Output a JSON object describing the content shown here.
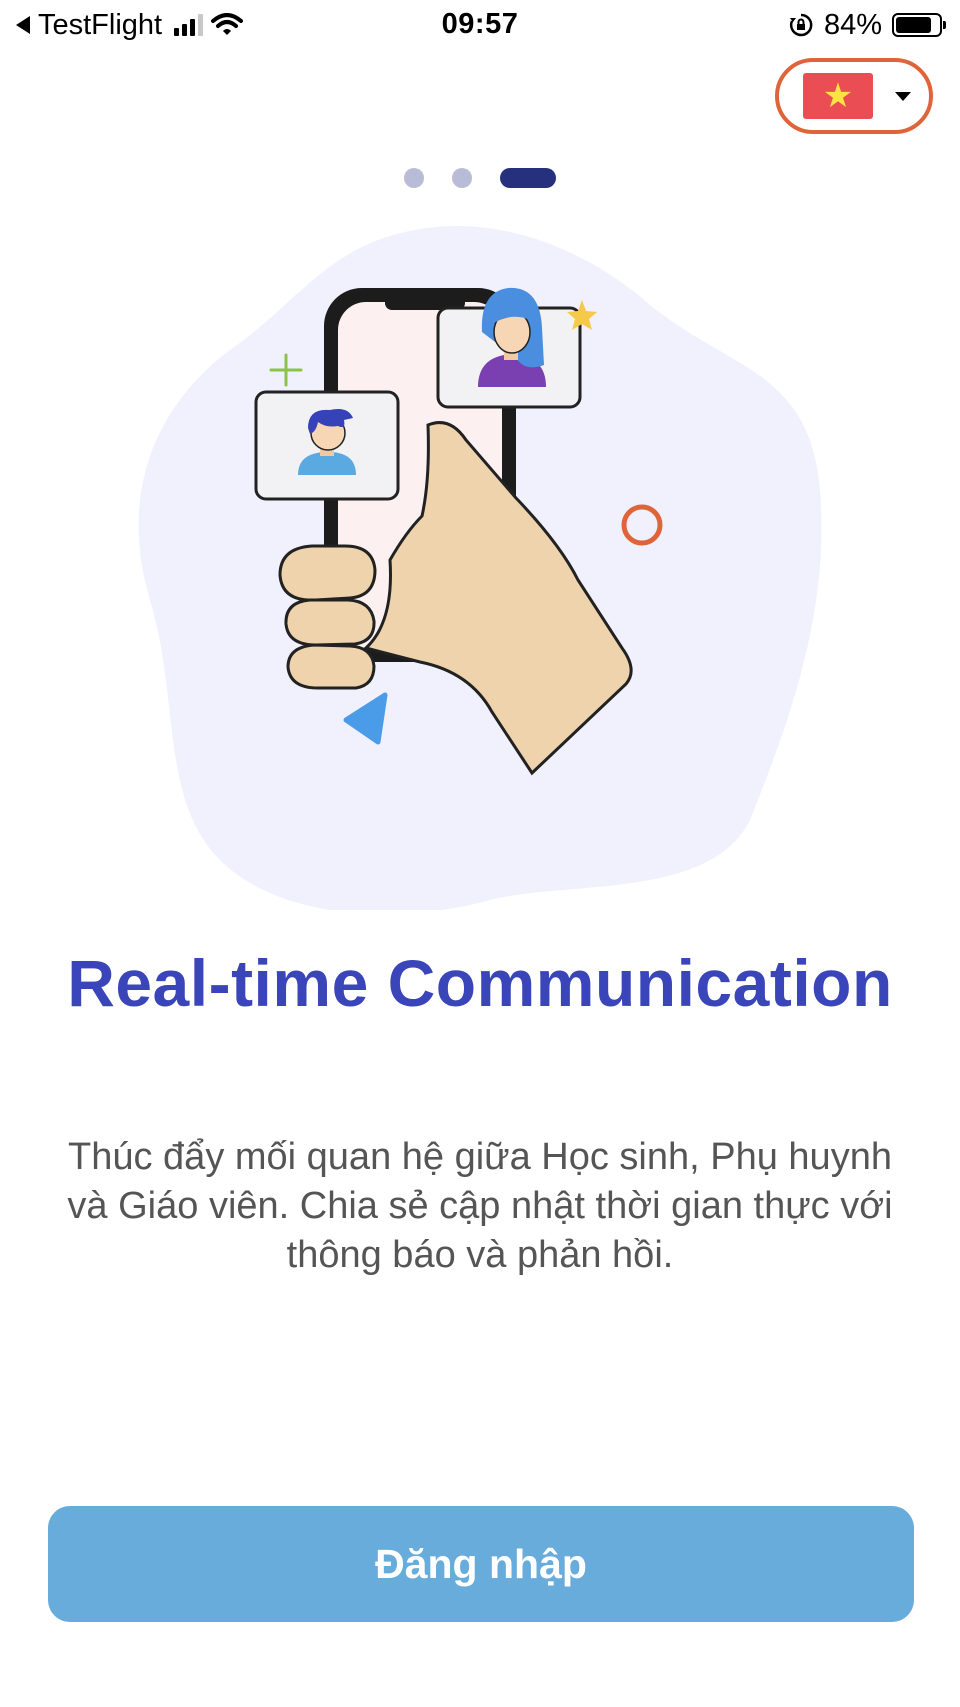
{
  "status_bar": {
    "back_app": "TestFlight",
    "time": "09:57",
    "battery": "84%",
    "battery_level": 0.84,
    "icons": [
      "back-arrow-icon",
      "signal-icon",
      "wifi-icon",
      "orientation-lock-icon",
      "battery-icon"
    ]
  },
  "language_selector": {
    "flag_icon": "vietnam-flag-icon",
    "flag_colors": {
      "background": "#ea4d54",
      "star": "#ffe342"
    },
    "ring_color": "#e0643a",
    "dropdown_icon": "caret-down-icon"
  },
  "pager": {
    "total": 3,
    "active_index": 2
  },
  "illustration": {
    "icon": "hand-holding-phone-video-call-illustration"
  },
  "onboarding": {
    "title": "Real-time Communication",
    "description": "Thúc đẩy mối quan hệ giữa Học sinh, Phụ huynh và Giáo viên. Chia sẻ cập nhật thời gian thực với thông báo và phản hồi."
  },
  "login_button": {
    "label": "Đăng nhập"
  },
  "colors": {
    "title": "#3a45b9",
    "button": "#67acdb",
    "pager_active": "#26317e",
    "pager_inactive": "#b9bcd6",
    "blob": "#f1f0fd"
  }
}
